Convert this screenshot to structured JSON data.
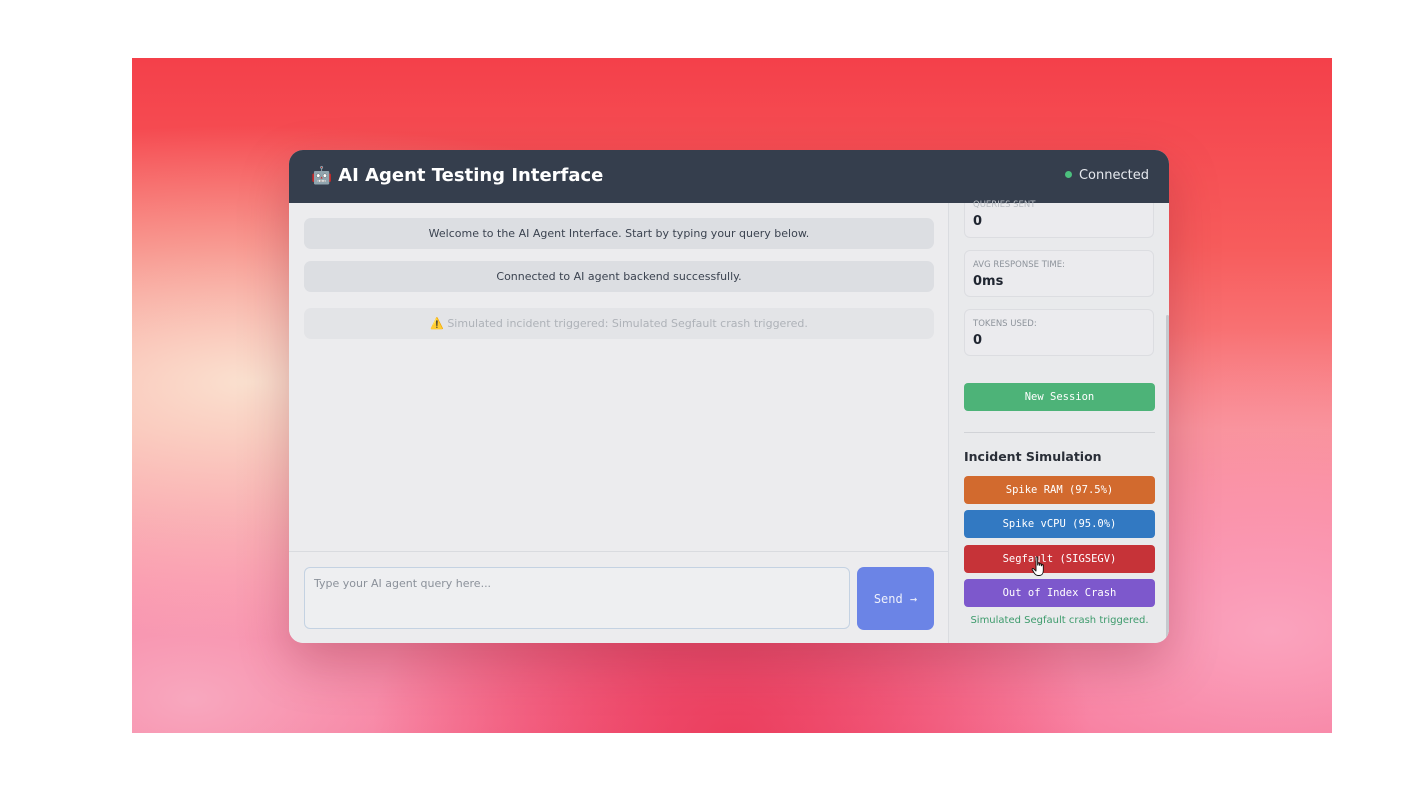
{
  "app": {
    "title": "AI Agent Testing Interface",
    "title_icon": "🤖",
    "status_label": "Connected",
    "status_color": "#4cc07e"
  },
  "chat": {
    "messages": [
      {
        "text": "Welcome to the AI Agent Interface. Start by typing your query below."
      },
      {
        "text": "Connected to AI agent backend successfully."
      },
      {
        "text": "⚠️ Simulated incident triggered: Simulated Segfault crash triggered."
      }
    ],
    "input_placeholder": "Type your AI agent query here...",
    "input_value": "",
    "send_label": "Send →"
  },
  "stats": {
    "queries_sent": {
      "label": "QUERIES SENT",
      "value": "0"
    },
    "avg_response_time": {
      "label": "AVG RESPONSE TIME:",
      "value": "0ms"
    },
    "tokens_used": {
      "label": "TOKENS USED:",
      "value": "0"
    }
  },
  "session": {
    "new_session_label": "New Session"
  },
  "incident": {
    "section_title": "Incident Simulation",
    "buttons": [
      {
        "label": "Spike RAM (97.5%)",
        "color": "#d26a2e"
      },
      {
        "label": "Spike vCPU (95.0%)",
        "color": "#3279c2"
      },
      {
        "label": "Segfault (SIGSEGV)",
        "color": "#c63338"
      },
      {
        "label": "Out of Index Crash",
        "color": "#7d58cc"
      }
    ],
    "status_message": "Simulated Segfault crash triggered."
  },
  "colors": {
    "titlebar": "#353e4d",
    "send_button": "#6b84e6",
    "new_session": "#4db378"
  }
}
